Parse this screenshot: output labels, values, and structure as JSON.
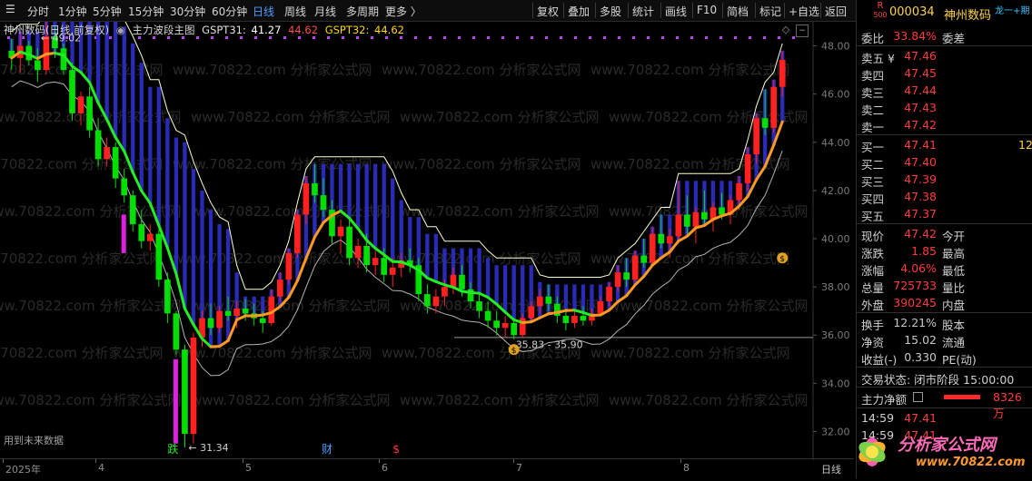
{
  "toolbar": {
    "left": [
      "分时",
      "1分钟",
      "5分钟",
      "15分钟",
      "30分钟",
      "60分钟",
      "日线",
      "周线",
      "月线",
      "多周期",
      "更多 〉"
    ],
    "active": "日线",
    "right": [
      "复权",
      "叠加",
      "多股",
      "统计",
      "画线",
      "F10",
      "简档",
      "标记",
      "+自选",
      "返回"
    ]
  },
  "legend": {
    "stock": "神州数码(日线,前复权)",
    "indicator": "主力波段主图",
    "g31_label": "GSPT31:",
    "g31_a": "41.27",
    "g31_b": "44.62",
    "g32_label": "GSPT32:",
    "g32_val": "44.62"
  },
  "chart_labels": {
    "high_note": "49.02",
    "low_note": "31.34",
    "range_note": "35.83 - 35.90",
    "future_text": "用到未来数据",
    "fall_mark": "跌",
    "finance_mark": "财",
    "dollar_mark": "$",
    "watermark": "www.70822.com 分析家公式网"
  },
  "y_axis": [
    "48.00",
    "46.00",
    "44.00",
    "42.00",
    "40.00",
    "38.00",
    "36.00",
    "34.00",
    "32.00"
  ],
  "x_axis": [
    "2025年",
    "4",
    "5",
    "6",
    "7",
    "8"
  ],
  "x_axis_right": "日线",
  "quote": {
    "r_badge": "R",
    "r_sub": "500",
    "code": "000034",
    "name": "神州数码",
    "tag": "龙一+期",
    "weibi_label": "委比",
    "weibi": "33.84%",
    "weicha_label": "委差",
    "asks": [
      {
        "label": "卖五 ¥",
        "price": "47.46"
      },
      {
        "label": "卖四",
        "price": "47.45"
      },
      {
        "label": "卖三",
        "price": "47.44"
      },
      {
        "label": "卖二",
        "price": "47.43"
      },
      {
        "label": "卖一",
        "price": "47.42"
      }
    ],
    "bids": [
      {
        "label": "买一",
        "price": "47.41",
        "vol": "12"
      },
      {
        "label": "买二",
        "price": "47.40",
        "vol": ""
      },
      {
        "label": "买三",
        "price": "47.39",
        "vol": ""
      },
      {
        "label": "买四",
        "price": "47.38",
        "vol": ""
      },
      {
        "label": "买五",
        "price": "47.37",
        "vol": ""
      }
    ],
    "stats": [
      {
        "l1": "现价",
        "v1": "47.42",
        "l2": "今开"
      },
      {
        "l1": "涨跌",
        "v1": "1.85",
        "l2": "最高"
      },
      {
        "l1": "涨幅",
        "v1": "4.06%",
        "l2": "最低"
      },
      {
        "l1": "总量",
        "v1": "725733",
        "l2": "量比"
      },
      {
        "l1": "外盘",
        "v1": "390245",
        "l2": "内盘"
      }
    ],
    "stats2": [
      {
        "l1": "换手",
        "v1": "12.21%",
        "l2": "股本"
      },
      {
        "l1": "净资",
        "v1": "15.02",
        "l2": "流通"
      },
      {
        "l1": "收益(-)",
        "v1": "0.330",
        "l2": "PE(动)"
      }
    ],
    "trade_status": "交易状态: 闭市阶段 15:00:00",
    "main_net_label": "主力净额",
    "main_net_value": "8326万",
    "ticks": [
      {
        "time": "14:59",
        "price": "47.41"
      },
      {
        "time": "14:59",
        "price": "47.41"
      }
    ]
  },
  "brand": {
    "name": "分析家公式网",
    "url": "www.70822.com"
  },
  "colors": {
    "up": "#ff2020",
    "down": "#00e000",
    "bg": "#000000",
    "accent": "#4aa0ff",
    "ma_green": "#22ee22",
    "ma_orange": "#ff9a20",
    "band": "#ffffbb"
  },
  "chart_data": {
    "type": "candlestick",
    "ylim": [
      31,
      49
    ],
    "y_ticks": [
      32,
      34,
      36,
      38,
      40,
      42,
      44,
      46,
      48
    ],
    "high": 49.02,
    "low": 31.34,
    "support_line": 35.9,
    "ohlc": [
      [
        47.8,
        48.3,
        47.0,
        47.5
      ],
      [
        47.5,
        48.6,
        46.9,
        48.0
      ],
      [
        48.0,
        48.2,
        47.2,
        47.4
      ],
      [
        47.4,
        47.9,
        46.5,
        47.0
      ],
      [
        47.0,
        49.02,
        46.8,
        48.4
      ],
      [
        48.4,
        48.8,
        47.5,
        47.9
      ],
      [
        47.9,
        48.1,
        46.8,
        47.0
      ],
      [
        47.0,
        47.3,
        44.9,
        45.2
      ],
      [
        45.2,
        46.1,
        44.7,
        45.9
      ],
      [
        45.9,
        46.3,
        44.2,
        44.5
      ],
      [
        44.5,
        45.0,
        43.0,
        43.3
      ],
      [
        43.3,
        44.2,
        43.0,
        43.8
      ],
      [
        43.8,
        44.0,
        42.1,
        42.5
      ],
      [
        42.5,
        42.9,
        41.5,
        41.8
      ],
      [
        41.8,
        42.0,
        40.3,
        40.6
      ],
      [
        40.6,
        41.2,
        39.6,
        39.9
      ],
      [
        39.9,
        40.6,
        39.5,
        40.2
      ],
      [
        40.2,
        40.4,
        38.0,
        38.3
      ],
      [
        38.3,
        38.6,
        36.5,
        36.9
      ],
      [
        36.9,
        37.0,
        35.2,
        35.4
      ],
      [
        35.4,
        35.6,
        31.34,
        31.9
      ],
      [
        31.9,
        36.1,
        31.5,
        35.9
      ],
      [
        35.9,
        37.0,
        35.5,
        36.7
      ],
      [
        36.7,
        37.3,
        36.0,
        36.3
      ],
      [
        36.3,
        37.2,
        36.1,
        37.0
      ],
      [
        37.0,
        37.6,
        36.6,
        36.8
      ],
      [
        36.8,
        37.4,
        36.3,
        37.1
      ],
      [
        37.1,
        37.5,
        36.6,
        36.9
      ],
      [
        36.9,
        37.3,
        36.4,
        36.7
      ],
      [
        36.7,
        37.0,
        36.1,
        36.5
      ],
      [
        36.5,
        37.9,
        36.4,
        37.6
      ],
      [
        37.6,
        38.6,
        37.4,
        38.3
      ],
      [
        38.3,
        39.6,
        38.1,
        39.4
      ],
      [
        39.4,
        41.2,
        39.2,
        41.0
      ],
      [
        41.0,
        42.6,
        40.6,
        42.3
      ],
      [
        42.3,
        43.1,
        41.5,
        41.8
      ],
      [
        41.8,
        42.5,
        40.9,
        41.2
      ],
      [
        41.2,
        41.6,
        39.8,
        40.1
      ],
      [
        40.1,
        40.8,
        39.4,
        40.5
      ],
      [
        40.5,
        40.9,
        38.9,
        39.2
      ],
      [
        39.2,
        40.0,
        38.8,
        39.7
      ],
      [
        39.7,
        40.2,
        38.6,
        38.9
      ],
      [
        38.9,
        39.5,
        38.5,
        39.2
      ],
      [
        39.2,
        39.6,
        38.2,
        38.5
      ],
      [
        38.5,
        39.2,
        38.0,
        38.8
      ],
      [
        38.8,
        39.4,
        38.4,
        39.1
      ],
      [
        39.1,
        39.6,
        38.6,
        38.9
      ],
      [
        38.9,
        39.2,
        37.4,
        37.7
      ],
      [
        37.7,
        38.1,
        36.9,
        37.2
      ],
      [
        37.2,
        37.9,
        36.9,
        37.6
      ],
      [
        37.6,
        38.3,
        37.2,
        38.0
      ],
      [
        38.0,
        38.8,
        37.7,
        38.5
      ],
      [
        38.5,
        38.9,
        37.6,
        37.9
      ],
      [
        37.9,
        38.2,
        37.1,
        37.4
      ],
      [
        37.4,
        37.8,
        36.7,
        37.0
      ],
      [
        37.0,
        37.4,
        36.3,
        36.6
      ],
      [
        36.6,
        37.0,
        36.0,
        36.3
      ],
      [
        36.3,
        36.8,
        35.9,
        36.5
      ],
      [
        36.5,
        36.7,
        35.83,
        36.0
      ],
      [
        36.0,
        36.9,
        35.9,
        36.7
      ],
      [
        36.7,
        37.4,
        36.5,
        37.2
      ],
      [
        37.2,
        37.9,
        36.9,
        37.6
      ],
      [
        37.6,
        38.1,
        37.0,
        37.3
      ],
      [
        37.3,
        37.6,
        36.5,
        36.8
      ],
      [
        36.8,
        37.1,
        36.2,
        36.5
      ],
      [
        36.5,
        37.0,
        36.3,
        36.8
      ],
      [
        36.8,
        37.2,
        36.4,
        36.6
      ],
      [
        36.6,
        37.1,
        36.4,
        36.9
      ],
      [
        36.9,
        37.6,
        36.8,
        37.4
      ],
      [
        37.4,
        38.2,
        37.2,
        38.0
      ],
      [
        38.0,
        38.9,
        37.8,
        38.6
      ],
      [
        38.6,
        39.2,
        38.0,
        38.3
      ],
      [
        38.3,
        39.5,
        38.2,
        39.3
      ],
      [
        39.3,
        40.0,
        38.8,
        39.0
      ],
      [
        39.0,
        40.5,
        38.9,
        40.2
      ],
      [
        40.2,
        41.0,
        39.6,
        39.8
      ],
      [
        39.8,
        40.4,
        39.2,
        40.1
      ],
      [
        40.1,
        42.4,
        39.8,
        41.0
      ],
      [
        41.0,
        41.8,
        40.2,
        40.5
      ],
      [
        40.5,
        41.3,
        39.8,
        41.1
      ],
      [
        41.1,
        42.0,
        40.6,
        40.8
      ],
      [
        40.8,
        41.5,
        40.3,
        41.3
      ],
      [
        41.3,
        41.9,
        40.8,
        41.0
      ],
      [
        41.0,
        41.8,
        40.6,
        41.6
      ],
      [
        41.6,
        42.6,
        41.2,
        42.3
      ],
      [
        42.3,
        43.8,
        42.0,
        43.5
      ],
      [
        43.5,
        45.2,
        43.1,
        45.0
      ],
      [
        45.0,
        46.2,
        44.3,
        44.6
      ],
      [
        44.6,
        46.6,
        44.4,
        46.3
      ],
      [
        46.3,
        47.8,
        45.9,
        47.42
      ]
    ]
  }
}
